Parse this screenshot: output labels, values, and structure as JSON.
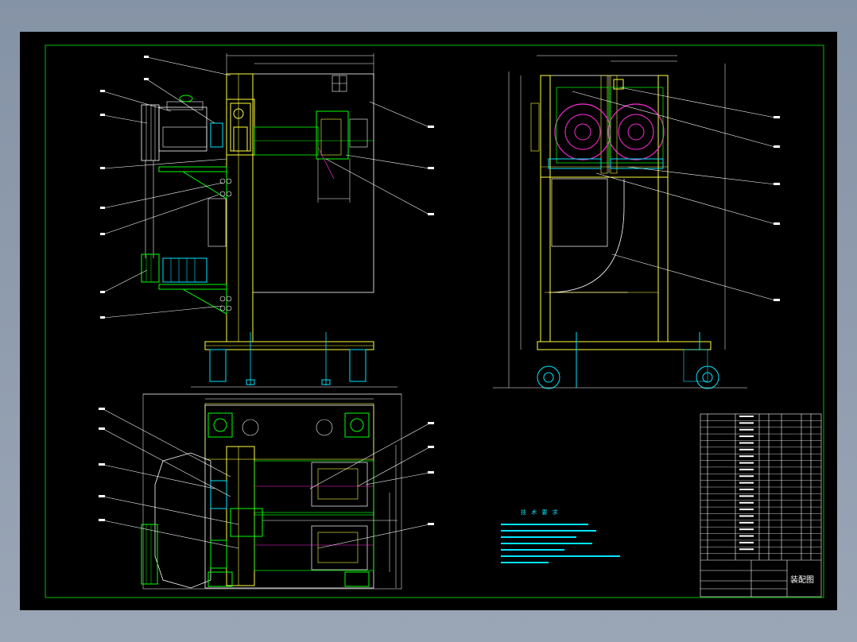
{
  "drawing": {
    "title": "装配图",
    "notes_heading": "技 术 要 求",
    "notes_count": 7,
    "part_count": 21
  },
  "colors": {
    "background": "#8e9aab",
    "paper": "#000000",
    "frame": "#00c000",
    "structure": "#ffff3c",
    "leader": "#ffffff",
    "cyan": "#00e5ff",
    "magenta": "#ff2bd6",
    "green": "#00ff00"
  }
}
